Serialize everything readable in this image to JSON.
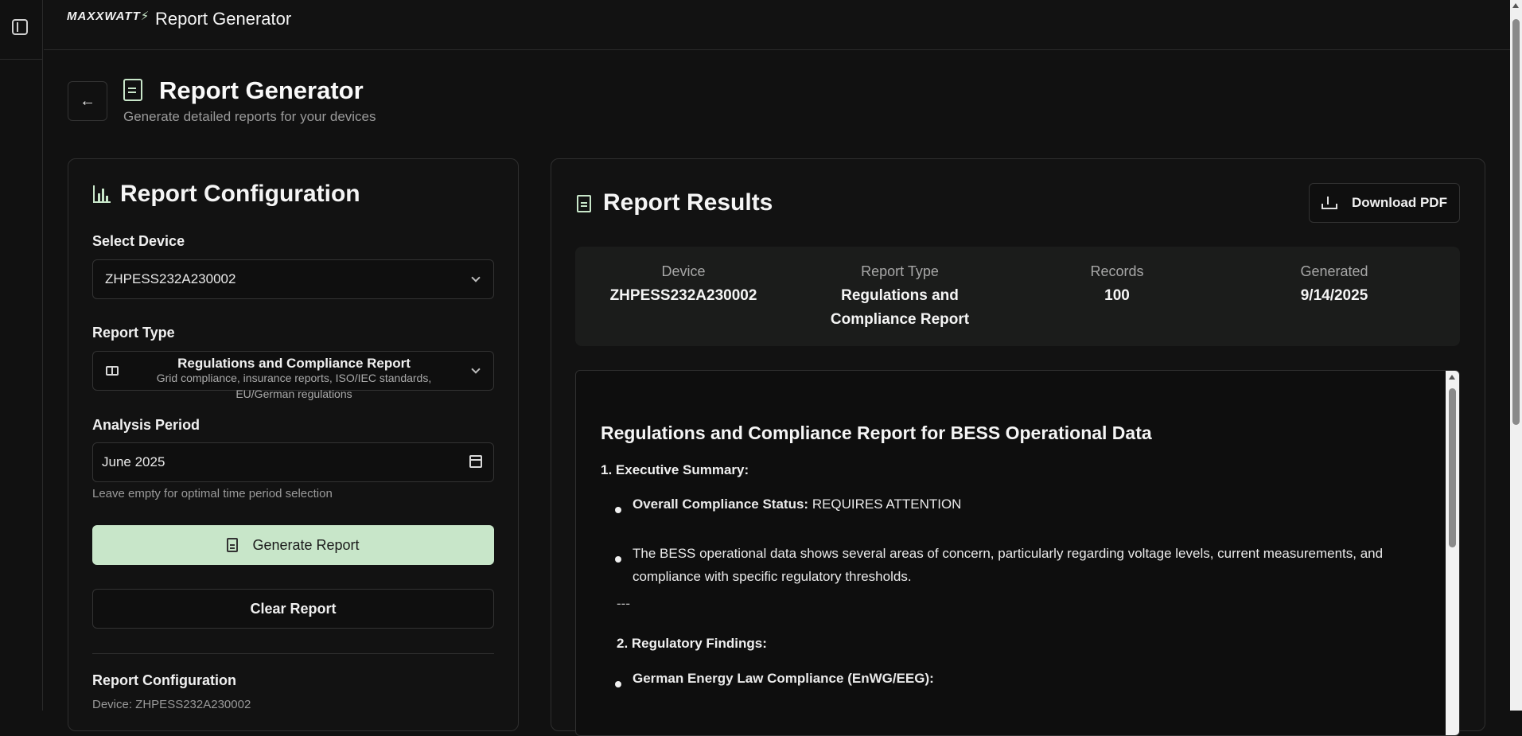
{
  "app": {
    "brand": "MAXXWATT",
    "title": "Report Generator"
  },
  "page": {
    "title": "Report Generator",
    "subtitle": "Generate detailed reports for your devices"
  },
  "config": {
    "title": "Report Configuration",
    "device_label": "Select Device",
    "device_value": "ZHPESS232A230002",
    "report_type_label": "Report Type",
    "report_type_value": "Regulations and Compliance Report",
    "report_type_desc": "Grid compliance, insurance reports, ISO/IEC standards, EU/German regulations",
    "period_label": "Analysis Period",
    "period_value": "June 2025",
    "period_hint": "Leave empty for optimal time period selection",
    "generate_label": "Generate Report",
    "clear_label": "Clear Report",
    "summary_title": "Report Configuration",
    "summary_device": "Device: ZHPESS232A230002"
  },
  "results": {
    "title": "Report Results",
    "download_label": "Download PDF",
    "stats": [
      {
        "key": "Device",
        "value": "ZHPESS232A230002"
      },
      {
        "key": "Report Type",
        "value": "Regulations and Compliance Report"
      },
      {
        "key": "Records",
        "value": "100"
      },
      {
        "key": "Generated",
        "value": "9/14/2025"
      }
    ],
    "report": {
      "heading": "Regulations and Compliance Report for BESS Operational Data",
      "section1": "1. Executive Summary:",
      "b1_label": "Overall Compliance Status:",
      "b1_value": "REQUIRES ATTENTION",
      "b2": "The BESS operational data shows several areas of concern, particularly regarding voltage levels, current measurements, and compliance with specific regulatory thresholds.",
      "hr": "---",
      "section2": "2. Regulatory Findings:",
      "b3": "German Energy Law Compliance (EnWG/EEG):"
    }
  },
  "colors": {
    "accent": "#c8e6c9",
    "background": "#111111"
  }
}
